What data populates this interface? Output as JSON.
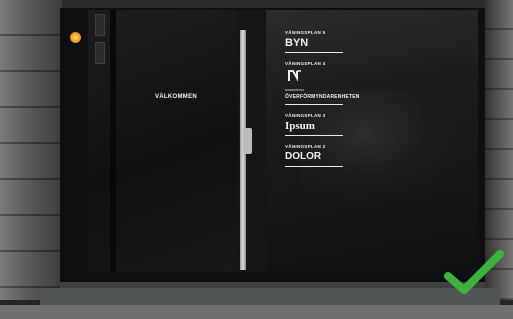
{
  "scene": {
    "accent_check": "#3cb43c",
    "lamp_color": "#f0a42c"
  },
  "door": {
    "welcome_text": "VÄLKOMMEN"
  },
  "directory": {
    "floors": [
      {
        "label": "VÅNINGSPLAN 5",
        "tenant": "BYN"
      },
      {
        "label": "VÅNINGSPLAN 4",
        "tenant_logo_text": "NORRKÖPING",
        "tenant_sub": "ÖVERFÖRMYNDARENHETEN"
      },
      {
        "label": "VÅNINGSPLAN 3",
        "tenant": "Ipsum"
      },
      {
        "label": "VÅNINGSPLAN 2",
        "tenant": "DOLOR"
      }
    ]
  },
  "icons": {
    "checkmark": "checkmark-icon",
    "logo": "norrkoping-logo-icon"
  }
}
